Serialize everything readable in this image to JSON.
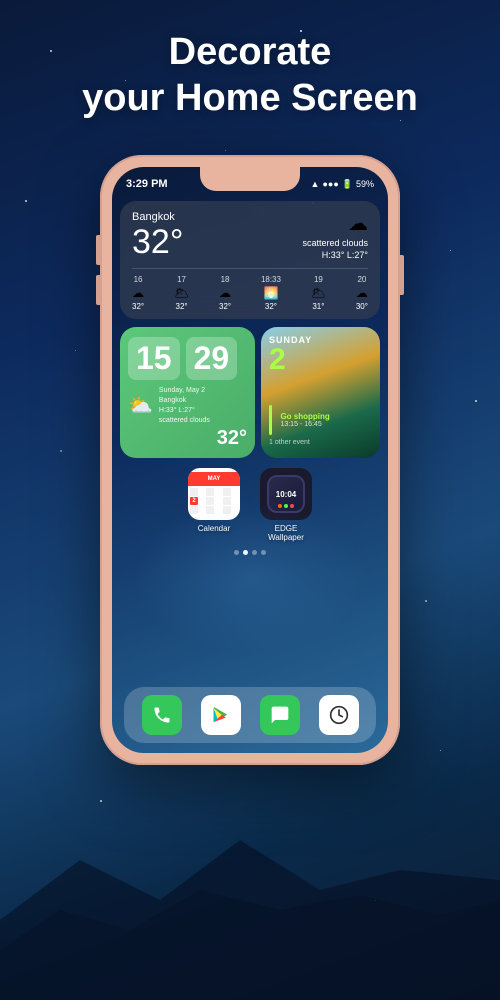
{
  "header": {
    "line1": "Decorate",
    "line2": "your Home Screen"
  },
  "phone": {
    "status_bar": {
      "time": "3:29 PM",
      "battery": "59%",
      "signal": "●●●",
      "wifi": "▲"
    },
    "weather_widget": {
      "city": "Bangkok",
      "temperature": "32°",
      "condition": "scattered clouds",
      "high": "H:33°",
      "low": "L:27°",
      "forecast": [
        {
          "hour": "16",
          "icon": "☁",
          "temp": "32°"
        },
        {
          "hour": "17",
          "icon": "☁",
          "temp": "32°"
        },
        {
          "hour": "18",
          "icon": "☁",
          "temp": "32°"
        },
        {
          "hour": "18:33",
          "icon": "🌅",
          "temp": "32°"
        },
        {
          "hour": "19",
          "icon": "☁",
          "temp": "31°"
        },
        {
          "hour": "20",
          "icon": "☁",
          "temp": "30°"
        }
      ]
    },
    "clock_widget": {
      "hour": "15",
      "minute": "29",
      "date_line1": "Sunday, May 2",
      "date_line2": "Bangkok",
      "date_line3": "H:33° L:27°",
      "date_line4": "scattered clouds",
      "temp": "32°"
    },
    "calendar_widget": {
      "day_name": "SUNDAY",
      "date_number": "2",
      "event_title": "Go shopping",
      "event_time": "13:15 - 16:45",
      "other_events": "1 other event"
    },
    "apps": [
      {
        "name": "Calendar",
        "type": "calendar",
        "header_text": "MAY"
      },
      {
        "name": "EDGE\nWallpaper",
        "type": "edge",
        "watch_time": "10:04"
      }
    ],
    "page_dots": [
      false,
      true,
      false,
      false
    ],
    "dock_apps": [
      "phone",
      "play-store",
      "messages",
      "clock"
    ]
  }
}
